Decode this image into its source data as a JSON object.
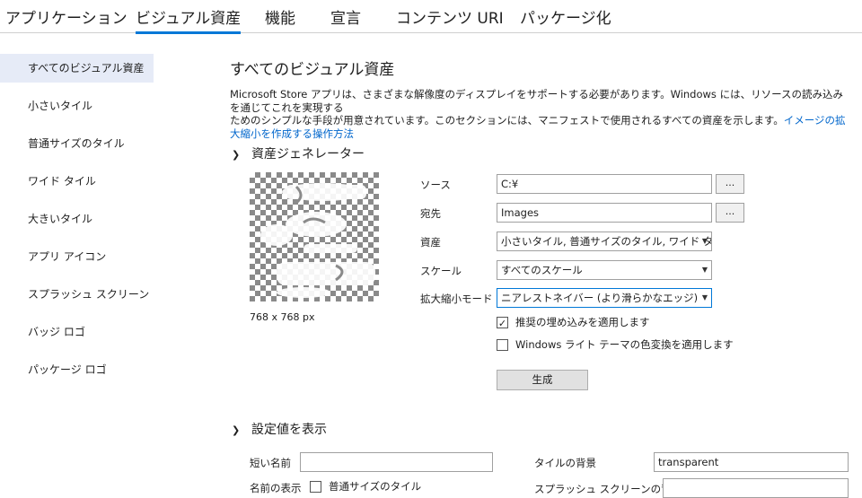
{
  "tabs": [
    {
      "label": "アプリケーション"
    },
    {
      "label": "ビジュアル資産"
    },
    {
      "label": "機能"
    },
    {
      "label": "宣言"
    },
    {
      "label": "コンテンツ URI"
    },
    {
      "label": "パッケージ化"
    }
  ],
  "active_tab": "ビジュアル資産",
  "sidebar": {
    "items": [
      {
        "label": "すべてのビジュアル資産"
      },
      {
        "label": "小さいタイル"
      },
      {
        "label": "普通サイズのタイル"
      },
      {
        "label": "ワイド タイル"
      },
      {
        "label": "大きいタイル"
      },
      {
        "label": "アプリ アイコン"
      },
      {
        "label": "スプラッシュ スクリーン"
      },
      {
        "label": "バッジ ロゴ"
      },
      {
        "label": "パッケージ ロゴ"
      }
    ],
    "selected": "すべてのビジュアル資産"
  },
  "main": {
    "title": "すべてのビジュアル資産",
    "description_line1": "Microsoft Store アプリは、さまざまな解像度のディスプレイをサポートする必要があります。Windows には、リソースの読み込みを通じてこれを実現する",
    "description_line2": "ためのシンプルな手段が用意されています。このセクションには、マニフェストで使用されるすべての資産を示します。",
    "description_link": "イメージの拡大縮小を作成する操作方法",
    "generator": {
      "section_label": "資産ジェネレーター",
      "preview_dimensions": "768 x 768 px",
      "source_label": "ソース",
      "source_value": "C:¥",
      "destination_label": "宛先",
      "destination_value": "Images",
      "browse_label": "...",
      "assets_label": "資産",
      "assets_value": "小さいタイル, 普通サイズのタイル, ワイド タイ...",
      "scale_label": "スケール",
      "scale_value": "すべてのスケール",
      "scaling_mode_label": "拡大縮小モード",
      "scaling_mode_value": "ニアレストネイバー (より滑らかなエッジ)",
      "padding_checkbox_label": "推奨の埋め込みを適用します",
      "padding_checked": true,
      "lighttheme_checkbox_label": "Windows ライト テーマの色変換を適用します",
      "lighttheme_checked": false,
      "generate_button": "生成"
    },
    "default_values": {
      "section_label": "設定値を表示",
      "short_name_label": "短い名前",
      "short_name_value": "",
      "tile_background_label": "タイルの背景",
      "tile_background_value": "transparent",
      "show_name_label": "名前の表示",
      "show_name_option": "普通サイズのタイル",
      "splash_background_label": "スプラッシュ スクリーンの背景"
    }
  },
  "colors": {
    "accent": "#0078d7",
    "link": "#0066cc",
    "sidebar_selected": "#e6ebf7"
  }
}
